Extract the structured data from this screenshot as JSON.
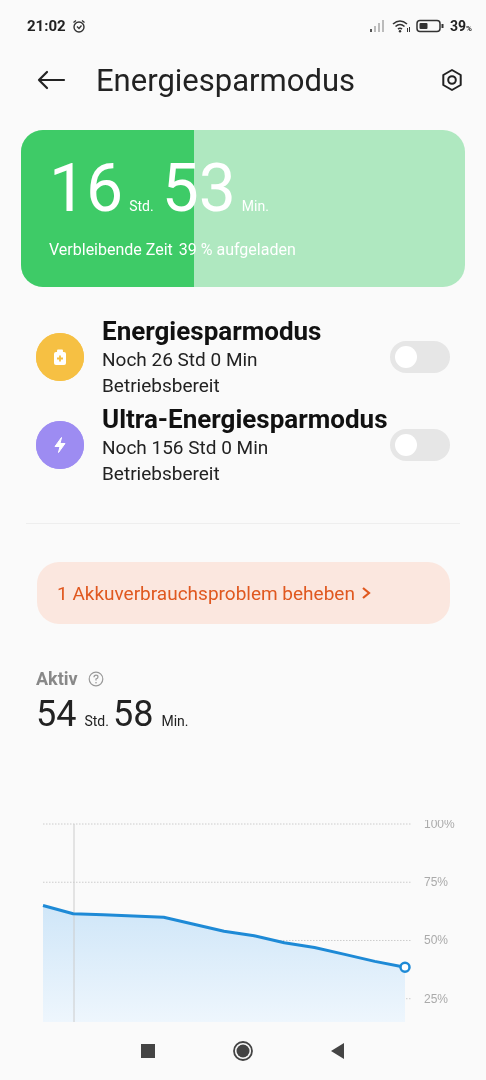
{
  "status_bar": {
    "time": "21:02",
    "battery": "39",
    "battery_unit": "%"
  },
  "header": {
    "title": "Energiesparmodus"
  },
  "battery_card": {
    "hours": "16",
    "hours_unit": "Std.",
    "minutes": "53",
    "minutes_unit": "Min.",
    "remaining_label": "Verbleibende Zeit",
    "charge_label": "39 % aufgeladen",
    "level": 0.39
  },
  "modes": [
    {
      "kind": "saver",
      "title": "Energiesparmodus",
      "line_1": "Noch 26 Std 0 Min",
      "line_2": "Betriebsbereit",
      "on": false
    },
    {
      "kind": "ultra",
      "title": "Ultra-Energiesparmodus",
      "line_1": "Noch 156 Std 0 Min",
      "line_2": "Betriebsbereit",
      "on": false
    }
  ],
  "problem_banner": {
    "text": "1 Akkuverbrauchsproblem beheben"
  },
  "active": {
    "label": "Aktiv",
    "hours": "54",
    "hours_unit": "Std.",
    "minutes": "58",
    "minutes_unit": "Min.",
    "chart_data": {
      "type": "area",
      "grid": true,
      "ylim": [
        15,
        100
      ],
      "yticks": [
        {
          "value": 25,
          "label": "25%"
        },
        {
          "value": 50,
          "label": "50%"
        },
        {
          "value": 75,
          "label": "75%"
        },
        {
          "value": 100,
          "label": "100%"
        }
      ],
      "series": [
        {
          "color": "#1e8ad6",
          "values": [
            65,
            61.5,
            61,
            60.5,
            60,
            57,
            54,
            52,
            49,
            47,
            44,
            41,
            38.5
          ]
        }
      ]
    }
  }
}
